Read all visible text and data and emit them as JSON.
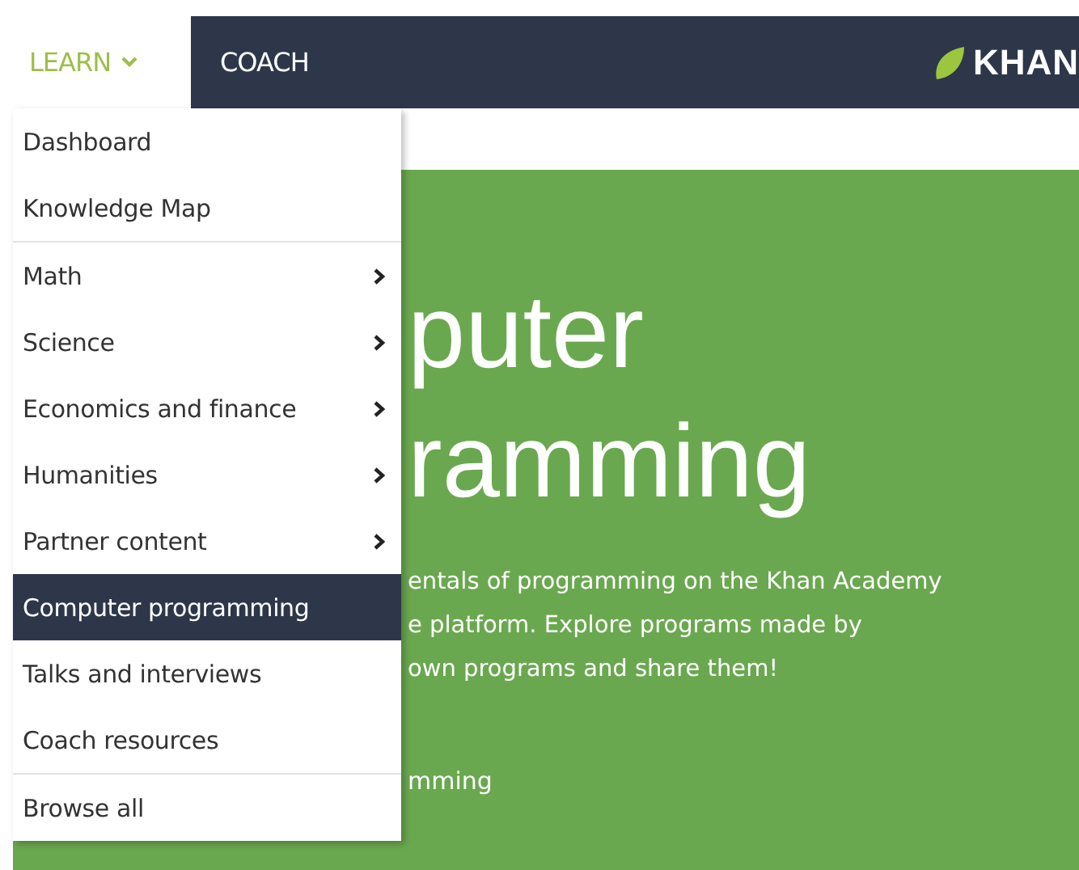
{
  "nav": {
    "tabs": [
      {
        "label": "LEARN",
        "selected": true,
        "dropdown": true
      },
      {
        "label": "COACH",
        "selected": false,
        "dropdown": false
      }
    ],
    "logo": "KHAN"
  },
  "menu": {
    "sections": [
      {
        "items": [
          {
            "label": "Dashboard",
            "selected": false,
            "submenu": false
          },
          {
            "label": "Knowledge Map",
            "selected": false,
            "submenu": false
          }
        ]
      },
      {
        "items": [
          {
            "label": "Math",
            "selected": false,
            "submenu": true
          },
          {
            "label": "Science",
            "selected": false,
            "submenu": true
          },
          {
            "label": "Economics and finance",
            "selected": false,
            "submenu": true
          },
          {
            "label": "Humanities",
            "selected": false,
            "submenu": true
          },
          {
            "label": "Partner content",
            "selected": false,
            "submenu": true
          },
          {
            "label": "Computer programming",
            "selected": true,
            "submenu": false
          },
          {
            "label": "Talks and interviews",
            "selected": false,
            "submenu": false
          },
          {
            "label": "Coach resources",
            "selected": false,
            "submenu": false
          }
        ]
      },
      {
        "items": [
          {
            "label": "Browse all",
            "selected": false,
            "submenu": false
          }
        ]
      }
    ]
  },
  "hero": {
    "heading_lines": [
      "puter",
      "ramming"
    ],
    "description_lines": [
      "entals of programming on the Khan Academy",
      "e platform. Explore programs made by",
      "own programs and share them!"
    ],
    "link": "mming"
  }
}
